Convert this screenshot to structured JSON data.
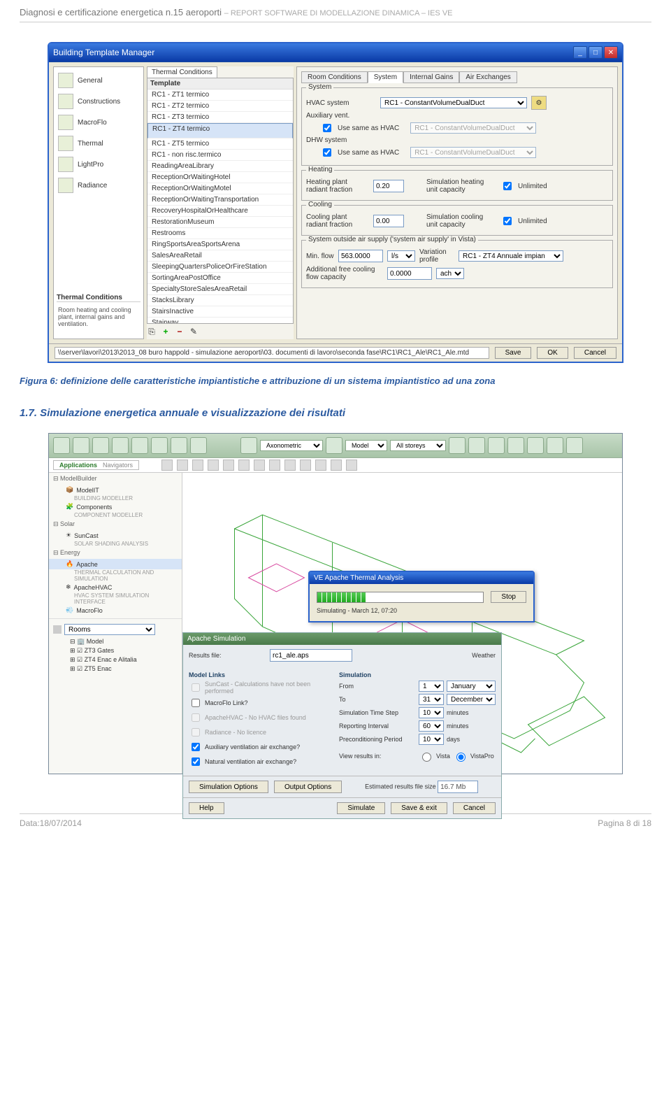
{
  "doc": {
    "header_left": "Diagnosi e certificazione energetica n.15 aeroporti",
    "header_right": "– REPORT SOFTWARE DI MODELLAZIONE DINAMICA – IES VE",
    "caption": "Figura 6: definizione delle caratteristiche impiantistiche e attribuzione di un sistema impiantistico ad una zona",
    "section": "1.7. Simulazione energetica annuale e visualizzazione dei risultati",
    "footer_left": "Data:18/07/2014",
    "footer_right": "Pagina 8 di 18"
  },
  "win1": {
    "title": "Building Template Manager",
    "left_items": [
      "General",
      "Constructions",
      "MacroFlo",
      "Thermal",
      "LightPro",
      "Radiance"
    ],
    "left_section_title": "Thermal Conditions",
    "left_desc": "Room heating and cooling plant, internal gains and ventilation.",
    "template_tab": "Thermal Conditions",
    "template_header": "Template",
    "templates": [
      "RC1 - ZT1 termico",
      "RC1 - ZT2 termico",
      "RC1 - ZT3 termico",
      "RC1 - ZT4 termico",
      "RC1 - ZT5 termico",
      "RC1 - non risc.termico",
      "ReadingAreaLibrary",
      "ReceptionOrWaitingHotel",
      "ReceptionOrWaitingMotel",
      "ReceptionOrWaitingTransportation",
      "RecoveryHospitalOrHealthcare",
      "RestorationMuseum",
      "Restrooms",
      "RingSportsAreaSportsArena",
      "SalesAreaRetail",
      "SleepingQuartersPoliceOrFireStation",
      "SortingAreaPostOffice",
      "SpecialtyStoreSalesAreaRetail",
      "StacksLibrary",
      "StairsInactive",
      "Stairway"
    ],
    "template_selected_index": 3,
    "right_tabs": [
      "Room Conditions",
      "System",
      "Internal Gains",
      "Air Exchanges"
    ],
    "right_tab_active": 1,
    "system_group_label": "System",
    "hvac_label": "HVAC system",
    "hvac_value": "RC1 - ConstantVolumeDualDuct",
    "aux_label": "Auxiliary vent.",
    "aux_chk_label": "Use same as HVAC",
    "aux_value": "RC1 - ConstantVolumeDualDuct",
    "dhw_label": "DHW system",
    "dhw_chk_label": "Use same as HVAC",
    "dhw_value": "RC1 - ConstantVolumeDualDuct",
    "heating_group_label": "Heating",
    "heating_plant_label": "Heating plant radiant fraction",
    "heating_plant_value": "0.20",
    "sim_heat_label": "Simulation heating unit capacity",
    "sim_heat_chk_label": "Unlimited",
    "cooling_group_label": "Cooling",
    "cooling_plant_label": "Cooling plant radiant fraction",
    "cooling_plant_value": "0.00",
    "sim_cool_label": "Simulation cooling unit capacity",
    "sim_cool_chk_label": "Unlimited",
    "air_group_label": "System outside air supply ('system air supply' in Vista)",
    "min_flow_label": "Min. flow",
    "min_flow_value": "563.0000",
    "min_flow_unit": "l/s",
    "var_prof_label": "Variation profile",
    "var_prof_value": "RC1 - ZT4 Annuale impian",
    "add_free_label": "Additional free cooling flow capacity",
    "add_free_value": "0.0000",
    "add_free_unit": "ach",
    "path": "\\\\server\\lavori\\2013\\2013_08 buro happold - simulazione aeroporti\\03. documenti di lavoro\\seconda fase\\RC1\\RC1_Ale\\RC1_Ale.mtd",
    "save_btn": "Save",
    "ok_btn": "OK",
    "cancel_btn": "Cancel"
  },
  "win2": {
    "toolbar_dd_axon": "Axonometric",
    "toolbar_dd_model": "Model",
    "toolbar_dd_storeys": "All storeys",
    "nav_applications_tab": "Applications",
    "nav_navigators_tab": "Navigators",
    "group_model": "ModelBuilder",
    "modelit": "ModelIT",
    "modelit_sub": "BUILDING MODELLER",
    "components": "Components",
    "components_sub": "COMPONENT MODELLER",
    "group_solar": "Solar",
    "suncast": "SunCast",
    "suncast_sub": "SOLAR SHADING ANALYSIS",
    "group_energy": "Energy",
    "apache": "Apache",
    "apache_sub": "THERMAL CALCULATION AND SIMULATION",
    "apachehvac": "ApacheHVAC",
    "apachehvac_sub": "HVAC SYSTEM SIMULATION INTERFACE",
    "macroflo": "MacroFlo",
    "rooms_label": "Rooms",
    "tree_model": "Model",
    "tree_items": [
      "ZT3 Gates",
      "ZT4 Enac e Alitalia",
      "ZT5 Enac"
    ],
    "progress_title": "VE Apache Thermal Analysis",
    "progress_status": "Simulating - March 12, 07:20",
    "progress_stop": "Stop",
    "sim_title": "Apache Simulation",
    "sim_results_label": "Results file:",
    "sim_results_value": "rc1_ale.aps",
    "sim_links_title": "Model Links",
    "sim_suncast": "SunCast - Calculations have not been performed",
    "sim_macroflo": "MacroFlo Link?",
    "sim_ahvac": "ApacheHVAC - No HVAC files found",
    "sim_radiance": "Radiance - No licence",
    "sim_auxvent": "Auxiliary ventilation air exchange?",
    "sim_natvent": "Natural ventilation air exchange?",
    "sim_sim_title": "Simulation",
    "sim_weather_label": "Weather",
    "sim_from_label": "From",
    "sim_from_day": "1",
    "sim_from_month": "January",
    "sim_to_label": "To",
    "sim_to_day": "31",
    "sim_to_month": "December",
    "sim_step_label": "Simulation Time Step",
    "sim_step_val": "10",
    "sim_step_unit": "minutes",
    "sim_report_label": "Reporting Interval",
    "sim_report_val": "60",
    "sim_report_unit": "minutes",
    "sim_precond_label": "Preconditioning Period",
    "sim_precond_val": "10",
    "sim_precond_unit": "days",
    "sim_view_label": "View results in:",
    "sim_view_vista": "Vista",
    "sim_view_vistapro": "VistaPro",
    "sim_est_label": "Estimated results file size",
    "sim_est_val": "16.7 Mb",
    "sim_btn_simopt": "Simulation Options",
    "sim_btn_outopt": "Output Options",
    "sim_btn_help": "Help",
    "sim_btn_sim": "Simulate",
    "sim_btn_save": "Save & exit",
    "sim_btn_cancel": "Cancel"
  }
}
